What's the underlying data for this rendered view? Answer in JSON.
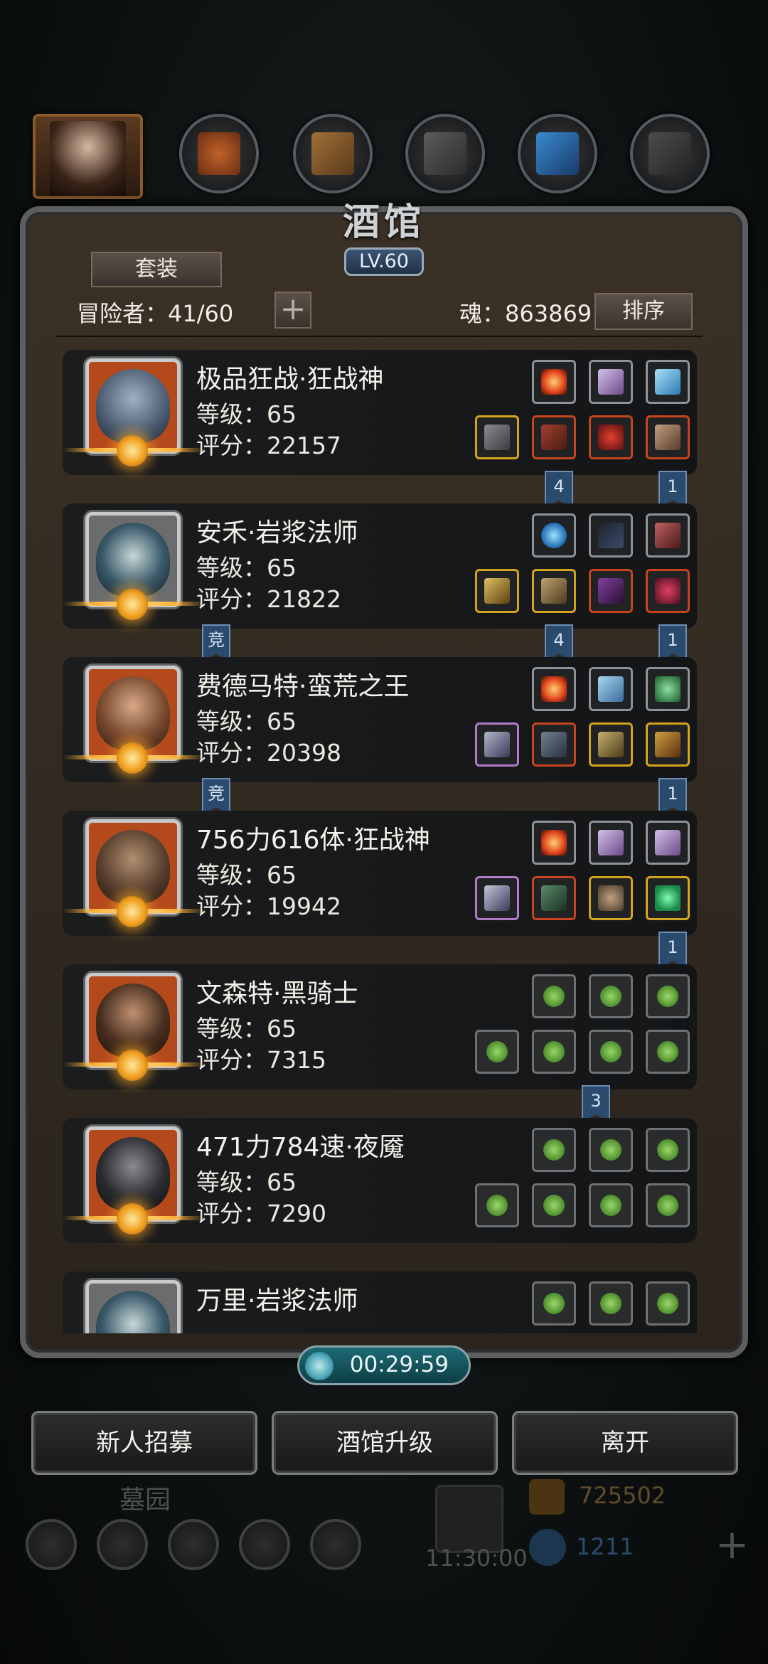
{
  "colors": {
    "accent_gold": "#d4a41c",
    "panel_bg": "#2a241d",
    "ribbon": "#2a4a6e",
    "timer_bg": "#1d6a74"
  },
  "header": {
    "title": "酒馆",
    "level": "LV.60"
  },
  "tabs": [
    {
      "icon": "hero-portrait-icon"
    },
    {
      "icon": "armor-icon"
    },
    {
      "icon": "scroll-icon"
    },
    {
      "icon": "anvil-icon"
    },
    {
      "icon": "crystal-icon"
    },
    {
      "icon": "stairs-icon"
    }
  ],
  "toolbar": {
    "set_label": "套装",
    "adventurer_text": "冒险者：41/60",
    "soul_text": "魂：863869",
    "sort_label": "排序",
    "plus": "+"
  },
  "heroes": [
    {
      "name": "极品狂战·狂战神",
      "level": "等级：65",
      "score": "评分：22157"
    },
    {
      "name": "安禾·岩浆法师",
      "level": "等级：65",
      "score": "评分：21822"
    },
    {
      "name": "费德马特·蛮荒之王",
      "level": "等级：65",
      "score": "评分：20398"
    },
    {
      "name": "756力616体·狂战神",
      "level": "等级：65",
      "score": "评分：19942"
    },
    {
      "name": "文森特·黑骑士",
      "level": "等级：65",
      "score": "评分：7315"
    },
    {
      "name": "471力784速·夜魇",
      "level": "等级：65",
      "score": "评分：7290"
    },
    {
      "name": "万里·岩浆法师",
      "level": "",
      "score": ""
    }
  ],
  "ribbons": {
    "r1": "4",
    "r2": "1",
    "r3": "竞",
    "r4": "4",
    "r5": "1",
    "r6": "竞",
    "r7": "1",
    "r8": "1",
    "r9": "3"
  },
  "timer": "00:29:59",
  "actions": {
    "recruit": "新人招募",
    "upgrade": "酒馆升级",
    "leave": "离开"
  },
  "background_hud": {
    "area": "墓园",
    "gold": "725502",
    "gems": "1211",
    "clock": "11:30:00"
  }
}
